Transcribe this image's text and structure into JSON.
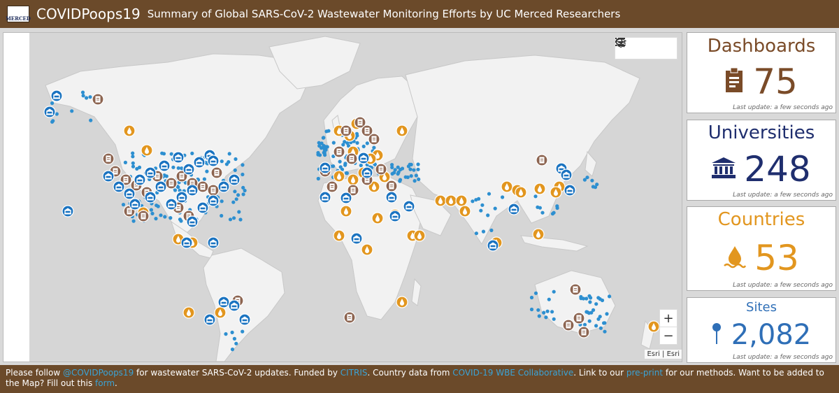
{
  "header": {
    "logo_text": "MERCED",
    "title": "COVIDPoops19",
    "subtitle": "Summary of Global SARS-CoV-2 Wastewater Monitoring Efforts by UC Merced Researchers"
  },
  "map": {
    "tools": [
      "search-icon",
      "legend-icon",
      "layers-icon"
    ],
    "zoom_in": "+",
    "zoom_out": "−",
    "attribution": "Esri | Esri"
  },
  "cards": {
    "dashboards": {
      "title": "Dashboards",
      "value": "75",
      "updated": "Last update: a few seconds ago",
      "color": "#7a4b28",
      "icon": "clipboard-icon"
    },
    "universities": {
      "title": "Universities",
      "value": "248",
      "updated": "Last update: a few seconds ago",
      "color": "#1f2e6e",
      "icon": "university-icon"
    },
    "countries": {
      "title": "Countries",
      "value": "53",
      "updated": "Last update: a few seconds ago",
      "color": "#e2961f",
      "icon": "water-drop-icon"
    },
    "sites": {
      "title": "Sites",
      "value": "2,082",
      "updated": "Last update: a few seconds ago",
      "color": "#2f6fb7",
      "icon": "map-pin-icon"
    }
  },
  "footer": {
    "t1": "Please follow ",
    "l1": "@COVIDPoops19",
    "t2": " for wastewater SARS-CoV-2 updates. Funded by ",
    "l2": "CITRIS",
    "t3": ". Country data from ",
    "l3": "COVID-19 WBE Collaborative",
    "t4": ". Link to our ",
    "l4": "pre-print",
    "t5": " for our methods. Want to be added to the Map? Fill out this ",
    "l5": "form",
    "t6": "."
  },
  "colors": {
    "header_bg": "#6b4a2a",
    "university_marker": "#1a73c0",
    "dashboard_marker": "#8c6450",
    "country_marker": "#e2961f",
    "site_dot": "#2d8fd0",
    "land": "#f2f2f2",
    "ocean": "#d6d6d6"
  }
}
